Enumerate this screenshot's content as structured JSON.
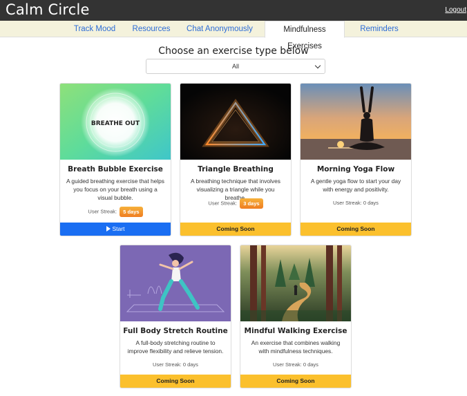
{
  "header": {
    "brand": "Calm Circle",
    "logout": "Logout"
  },
  "tabs": [
    {
      "label": "Track Mood"
    },
    {
      "label": "Resources"
    },
    {
      "label": "Chat Anonymously"
    },
    {
      "label": "Mindfulness Exercises",
      "active": true
    },
    {
      "label": "Reminders"
    }
  ],
  "main": {
    "heading": "Choose an exercise type below",
    "filter": {
      "selected": "All"
    }
  },
  "streak_label": "User Streak:",
  "colors": {
    "start": "#1a6ef2",
    "coming_soon": "#fbc02d",
    "badge": "#f5a623",
    "tab_link": "#2c6cd6",
    "header_bg": "#333333"
  },
  "cards": [
    {
      "title": "Breath Bubble Exercise",
      "description": "A guided breathing exercise that helps you focus on your breath using a visual bubble.",
      "streak_badge": "5 days",
      "button": "Start",
      "image_text": "BREATHE OUT"
    },
    {
      "title": "Triangle Breathing",
      "description": "A breathing technique that involves visualizing a triangle while you breathe.",
      "streak_badge": "3 days",
      "button": "Coming Soon"
    },
    {
      "title": "Morning Yoga Flow",
      "description": "A gentle yoga flow to start your day with energy and positivity.",
      "streak_plain": "0 days",
      "button": "Coming Soon"
    },
    {
      "title": "Full Body Stretch Routine",
      "description": "A full-body stretching routine to improve flexibility and relieve tension.",
      "streak_plain": "0 days",
      "button": "Coming Soon"
    },
    {
      "title": "Mindful Walking Exercise",
      "description": "An exercise that combines walking with mindfulness techniques.",
      "streak_plain": "0 days",
      "button": "Coming Soon"
    }
  ]
}
